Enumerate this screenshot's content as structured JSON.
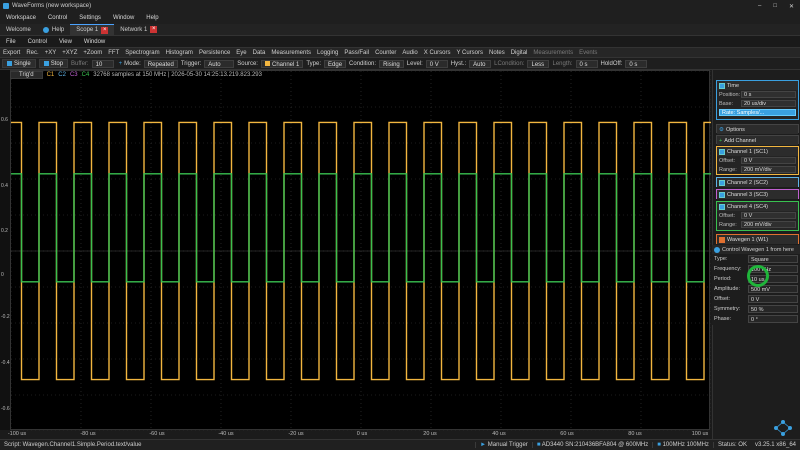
{
  "window": {
    "title": "WaveForms (new workspace)"
  },
  "menu": [
    "Workspace",
    "Control",
    "Settings",
    "Window",
    "Help"
  ],
  "tabs": [
    {
      "label": "Welcome",
      "active": false
    },
    {
      "label": "Help",
      "active": false
    },
    {
      "label": "Scope 1",
      "active": true
    },
    {
      "label": "Network 1",
      "active": false
    }
  ],
  "submenu": [
    "File",
    "Control",
    "View",
    "Window"
  ],
  "tools": [
    "Export",
    "Rec.",
    "+XY",
    "+XYZ",
    "+Zoom",
    "FFT",
    "Spectrogram",
    "Histogram",
    "Persistence",
    "Eye",
    "Data",
    "Measurements",
    "Logging",
    "Pass/Fail",
    "Counter",
    "Audio",
    "X Cursors",
    "Y Cursors",
    "Notes",
    "Digital",
    "Measurements",
    "Events"
  ],
  "acq": {
    "single": "Single",
    "stop": "Stop",
    "buffer_label": "Buffer:",
    "buffer": "10",
    "mode_label": "Mode:",
    "mode": "Repeated",
    "trigger_label": "Trigger:",
    "trigger": "Auto",
    "source_label": "Source:",
    "source": "Channel 1",
    "type_label": "Type:",
    "type": "Edge",
    "condition_label": "Condition:",
    "condition": "Rising",
    "level_label": "Level:",
    "level": "0 V",
    "hyst_label": "Hyst.:",
    "hyst": "Auto",
    "lcond_label": "LCondition:",
    "lcond": "Less",
    "length_label": "Length:",
    "length": "0 s",
    "holdoff_label": "HoldOff:",
    "holdoff": "0 s"
  },
  "infobar": {
    "trigd": "Trig'd",
    "channels": [
      "C1",
      "C2",
      "C3",
      "C4"
    ],
    "info": "32768 samples at 150 MHz | 2026-05-30 14:25:13.219.823.293"
  },
  "y_ticks": [
    "0.6",
    "0.4",
    "0.2",
    "0",
    "-0.2",
    "-0.4",
    "-0.6"
  ],
  "x_ticks": [
    "-100 us",
    "-80 us",
    "-60 us",
    "-40 us",
    "-20 us",
    "0 us",
    "20 us",
    "40 us",
    "60 us",
    "80 us",
    "100 us"
  ],
  "time": {
    "title": "Time",
    "position_label": "Position:",
    "position": "0 s",
    "base_label": "Base:",
    "base": "20 us/div",
    "rate": "Rate: Samples/...",
    "options": "Options",
    "add_channel": "Add Channel"
  },
  "channels": [
    {
      "name": "Channel 1 (SC1)",
      "color": "#f2b640",
      "offset_label": "Offset:",
      "offset": "0 V",
      "range_label": "Range:",
      "range": "200 mV/div",
      "expanded": true
    },
    {
      "name": "Channel 2 (SC2)",
      "color": "#5fb3e8",
      "expanded": false
    },
    {
      "name": "Channel 3 (SC3)",
      "color": "#c060d0",
      "expanded": false
    },
    {
      "name": "Channel 4 (SC4)",
      "color": "#39c150",
      "offset_label": "Offset:",
      "offset": "0 V",
      "range_label": "Range:",
      "range": "200 mV/div",
      "expanded": true
    }
  ],
  "wavegen_tab": "Wavegen 1 (W1)",
  "wavegen": {
    "header": "Control Wavegen 1 from here",
    "type_label": "Type:",
    "type": "Square",
    "rows": [
      {
        "label": "Frequency:",
        "value": "100 kHz"
      },
      {
        "label": "Period:",
        "value": "10 us"
      },
      {
        "label": "Amplitude:",
        "value": "500 mV"
      },
      {
        "label": "Offset:",
        "value": "0 V"
      },
      {
        "label": "Symmetry:",
        "value": "50 %"
      },
      {
        "label": "Phase:",
        "value": "0 °"
      }
    ]
  },
  "status": {
    "script": "Script: Wavegen.Channel1.Simple.Period.text/value",
    "manual_trigger": "Manual Trigger",
    "device": "AD3440 SN:210436BFA804 @ 600MHz",
    "clock": "100MHz 100MHz",
    "state": "Status: OK",
    "version": "v3.25.1 x86_64"
  },
  "chart_data": {
    "type": "line",
    "x_unit": "us",
    "xlim": [
      -100,
      100
    ],
    "ylim": [
      -0.7,
      0.7
    ],
    "grid": true,
    "series": [
      {
        "color": "#f2b640",
        "waveform": "square",
        "period_us": 10,
        "high": 0.5,
        "low": -0.5,
        "phase_us": -2
      },
      {
        "color": "#39c150",
        "waveform": "square",
        "period_us": 10,
        "high": 0.3,
        "low": -0.12,
        "phase_us": -2
      }
    ]
  }
}
